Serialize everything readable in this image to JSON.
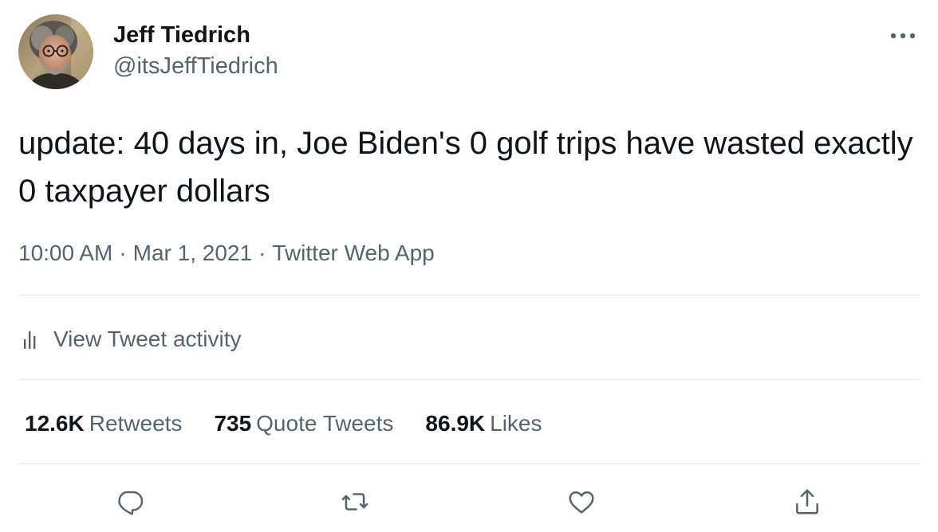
{
  "author": {
    "name": "Jeff Tiedrich",
    "handle": "@itsJeffTiedrich"
  },
  "tweet": {
    "text": "update: 40 days in, Joe Biden's 0 golf trips have wasted exactly 0 taxpayer dollars",
    "time": "10:00 AM",
    "date": "Mar 1, 2021",
    "separator": "·",
    "source": "Twitter Web App"
  },
  "activity": {
    "label": "View Tweet activity",
    "icon": "bar-chart-icon"
  },
  "stats": {
    "retweets_count": "12.6K",
    "retweets_label": "Retweets",
    "quotes_count": "735",
    "quotes_label": "Quote Tweets",
    "likes_count": "86.9K",
    "likes_label": "Likes"
  },
  "actions": {
    "reply_icon": "reply-icon",
    "retweet_icon": "retweet-icon",
    "like_icon": "heart-icon",
    "share_icon": "share-icon"
  },
  "colors": {
    "primary_text": "#0f1419",
    "secondary_text": "#536471",
    "divider": "#e3e7ea",
    "icon": "#536471"
  }
}
